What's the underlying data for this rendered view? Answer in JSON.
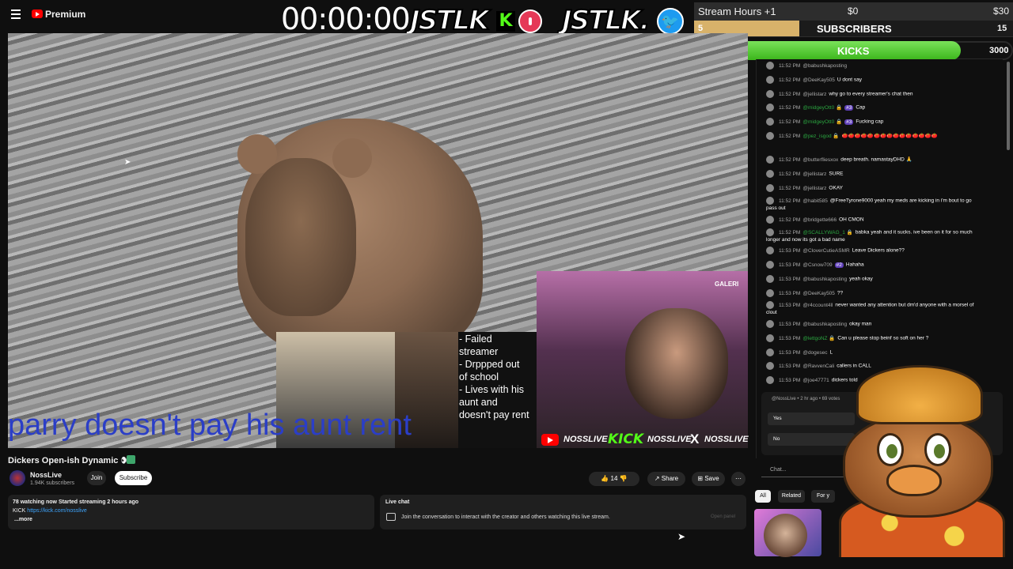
{
  "header": {
    "brand": "Premium",
    "timer": "00:00:00",
    "jstlk1": "JSTLK",
    "kick_letter": "K",
    "jstlk2": "JSTLK",
    "jstlk2_suffix": "."
  },
  "goals": {
    "title": "Stream Hours +1",
    "min": "$0",
    "max": "$30",
    "subs_current": "5",
    "subs_label": "SUBSCRIBERS",
    "subs_goal": "15",
    "subs_progress": 0.33,
    "kicks_current": "2510",
    "kicks_label": "KICKS",
    "kicks_goal": "3000",
    "kicks_progress": 0.84,
    "kick_color": "#53fc18",
    "sub_color": "#d8b26a"
  },
  "video": {
    "caption": "parry doesn't pay his aunt rent",
    "clip_text": "- Failed\nstreamer\n- Drppped out\nof school\n- Lives with his\naunt and\ndoesn't pay rent",
    "cam_sign": "GALERI",
    "social1": "NOSSLIVE",
    "social_kick": "KICK",
    "social2": "NOSSLIVE",
    "social_x": "X",
    "social3": "NOSSLIVE"
  },
  "info": {
    "title": "Dickers Open-ish Dynamic 👀",
    "channel": "NossLive",
    "subscribers": "1.94K subscribers",
    "join": "Join",
    "subscribe": "Subscribe",
    "likes": "👍 14",
    "dislike": "👎",
    "share": "↗ Share",
    "save": "⊞ Save",
    "more": "⋯"
  },
  "description": {
    "line1": "78 watching now  Started streaming 2 hours ago",
    "kick_label": "KICK ",
    "kick_link": "https://kick.com/nosslive",
    "more": "...more"
  },
  "live_chat": {
    "title": "Live chat",
    "text": "Join the conversation to interact with the creator and others watching this live stream.",
    "open": "Open panel"
  },
  "chat": {
    "messages": [
      {
        "time": "11:52 PM",
        "user": "@babushkaposting",
        "text": "",
        "green": false,
        "badge": ""
      },
      {
        "time": "11:52 PM",
        "user": "@DeeKay505",
        "text": "U dont say",
        "green": false,
        "badge": ""
      },
      {
        "time": "11:52 PM",
        "user": "@jellistarz",
        "text": "why go to every streamer's chat then",
        "green": false,
        "badge": ""
      },
      {
        "time": "11:52 PM",
        "user": "@midgeyOtt0 🔒",
        "text": "Cap",
        "green": true,
        "badge": "#3"
      },
      {
        "time": "11:52 PM",
        "user": "@midgeyOtt0 🔒",
        "text": "Fucking cap",
        "green": true,
        "badge": "#3"
      },
      {
        "time": "11:52 PM",
        "user": "@pez_isgod 🔒",
        "text": "🍅🍅🍅🍅🍅🍅🍅🍅🍅🍅🍅🍅🍅🍅🍅",
        "green": true,
        "badge": ""
      },
      {
        "time": "11:52 PM",
        "user": "@butterfliesxox",
        "text": "deep breath. namastayDHD 🙏",
        "green": false,
        "badge": ""
      },
      {
        "time": "11:52 PM",
        "user": "@jellistarz",
        "text": "SURE",
        "green": false,
        "badge": ""
      },
      {
        "time": "11:52 PM",
        "user": "@jellistarz",
        "text": "OKAY",
        "green": false,
        "badge": ""
      },
      {
        "time": "11:52 PM",
        "user": "@habit585",
        "text": "@FreeTyrone9000 yeah my meds are kicking in i'm bout to go pass out",
        "green": false,
        "badge": ""
      },
      {
        "time": "11:52 PM",
        "user": "@bridgette666",
        "text": "OH CMON",
        "green": false,
        "badge": ""
      },
      {
        "time": "11:52 PM",
        "user": "@SCALLYWAG_1 🔒",
        "text": "babka yeah and it sucks. ive been on it for so much longer and now its got a bad name",
        "green": true,
        "badge": ""
      },
      {
        "time": "11:53 PM",
        "user": "@CloverCutieASMR",
        "text": "Leave Dickers alone??",
        "green": false,
        "badge": ""
      },
      {
        "time": "11:53 PM",
        "user": "@Csnow709",
        "text": "Hahaha",
        "green": false,
        "badge": "#2"
      },
      {
        "time": "11:53 PM",
        "user": "@babushkaposting",
        "text": "yeah okay",
        "green": false,
        "badge": ""
      },
      {
        "time": "11:53 PM",
        "user": "@DeeKay505",
        "text": "??",
        "green": false,
        "badge": ""
      },
      {
        "time": "11:53 PM",
        "user": "@r4ccount4ll",
        "text": "never wanted any attention but dm'd anyone with a morsel of clout",
        "green": false,
        "badge": ""
      },
      {
        "time": "11:53 PM",
        "user": "@babushkaposting",
        "text": "okay man",
        "green": false,
        "badge": ""
      },
      {
        "time": "11:53 PM",
        "user": "@lettgoNZ 🔒",
        "text": "Can u please stop beinf so soft on her ?",
        "green": true,
        "badge": ""
      },
      {
        "time": "11:53 PM",
        "user": "@dogesec",
        "text": "L",
        "green": false,
        "badge": ""
      },
      {
        "time": "11:53 PM",
        "user": "@RavvenCali",
        "text": "callers in CALL",
        "green": false,
        "badge": ""
      },
      {
        "time": "11:53 PM",
        "user": "@joe47771",
        "text": "dickers told",
        "green": false,
        "badge": ""
      }
    ],
    "poll_head": "@NossLive • 2 hr ago • 69 votes",
    "poll_yes": "Yes",
    "poll_no": "No",
    "input_placeholder": "Chat...",
    "heart": "♡"
  },
  "tabs": {
    "all": "All",
    "related": "Related",
    "for_you": "For y"
  }
}
